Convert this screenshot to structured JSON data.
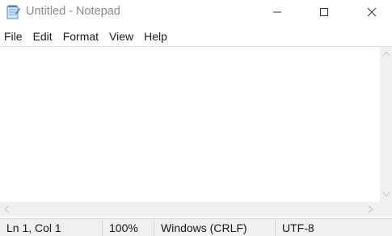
{
  "window": {
    "title": "Untitled - Notepad",
    "app_icon": "notepad-icon",
    "controls": {
      "minimize_icon": "minimize-icon",
      "maximize_icon": "maximize-icon",
      "close_icon": "close-icon"
    }
  },
  "menu": {
    "items": [
      "File",
      "Edit",
      "Format",
      "View",
      "Help"
    ]
  },
  "editor": {
    "content": ""
  },
  "status": {
    "position": "Ln 1, Col 1",
    "zoom": "100%",
    "line_ending": "Windows (CRLF)",
    "encoding": "UTF-8"
  }
}
